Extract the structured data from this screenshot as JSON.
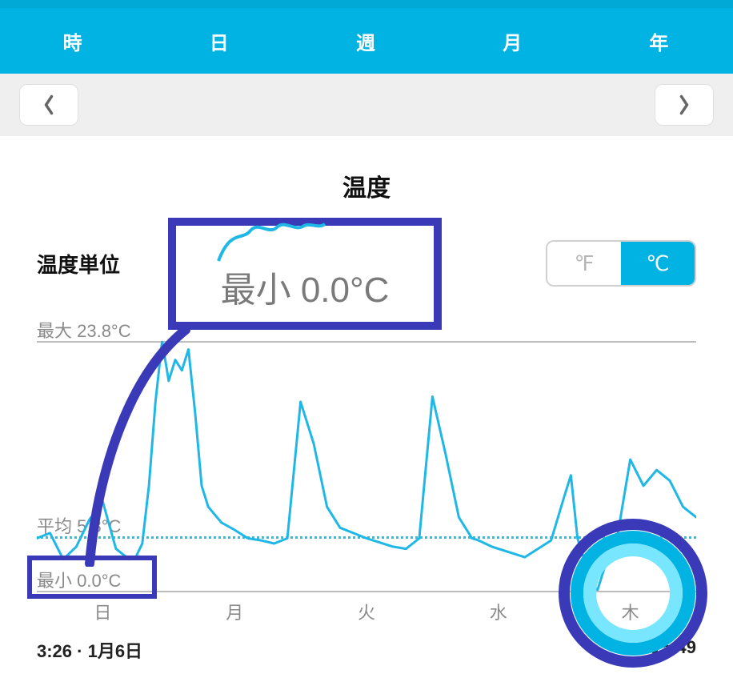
{
  "tabs": {
    "hour": "時",
    "day": "日",
    "week": "週",
    "month": "月",
    "year": "年"
  },
  "nav": {
    "prev_icon": "chevron-left",
    "next_icon": "chevron-right"
  },
  "title": "温度",
  "unit": {
    "label": "温度単位",
    "f": "℉",
    "c": "℃",
    "selected": "c"
  },
  "axis": {
    "max_label": "最大 23.8°C",
    "avg_label": "平均 5.8°C",
    "min_label": "最小 0.0°C"
  },
  "days": [
    "日",
    "月",
    "火",
    "水",
    "木"
  ],
  "time": {
    "start": "3:26 · 1月6日",
    "end": "15:49"
  },
  "callout": {
    "text": "最小 0.0°C"
  },
  "colors": {
    "brand": "#00b3e3",
    "highlight": "#3a3ab8",
    "ring_outer": "#3a3ab8",
    "ring_mid": "#00b3e3",
    "ring_inner": "#78e6ff"
  },
  "chart_data": {
    "type": "line",
    "title": "温度",
    "xlabel": "",
    "ylabel": "°C",
    "ylim": [
      0,
      23.8
    ],
    "y_reference": {
      "max": 23.8,
      "avg": 5.8,
      "min": 0.0
    },
    "x_categories": [
      "日",
      "月",
      "火",
      "水",
      "木"
    ],
    "x": [
      0,
      2,
      4,
      6,
      8,
      10,
      12,
      14,
      15,
      16,
      17,
      18,
      19,
      20,
      21,
      22,
      23,
      24,
      25,
      26,
      28,
      30,
      32,
      34,
      36,
      38,
      40,
      42,
      44,
      46,
      48,
      50,
      52,
      54,
      56,
      58,
      60,
      62,
      64,
      66,
      67,
      68,
      69,
      70,
      72,
      74,
      76,
      78,
      80,
      81,
      82,
      83,
      84,
      85,
      86,
      88,
      90,
      92,
      94,
      96,
      98,
      99,
      100
    ],
    "values": [
      5.0,
      5.5,
      3.0,
      4.2,
      6.8,
      8.5,
      4.0,
      3.0,
      3.2,
      4.5,
      10.0,
      18.0,
      23.8,
      20.0,
      22.0,
      21.0,
      23.0,
      17.0,
      10.0,
      8.0,
      6.5,
      5.8,
      5.0,
      4.8,
      4.5,
      5.0,
      18.0,
      14.0,
      8.0,
      6.0,
      5.5,
      5.0,
      4.6,
      4.2,
      4.0,
      5.0,
      18.5,
      13.0,
      7.0,
      5.0,
      4.8,
      4.5,
      4.2,
      4.0,
      3.6,
      3.2,
      4.0,
      4.8,
      9.0,
      11.0,
      5.0,
      3.0,
      1.0,
      0.0,
      2.0,
      5.0,
      12.5,
      10.0,
      11.5,
      10.5,
      8.0,
      7.5,
      7.0
    ]
  }
}
